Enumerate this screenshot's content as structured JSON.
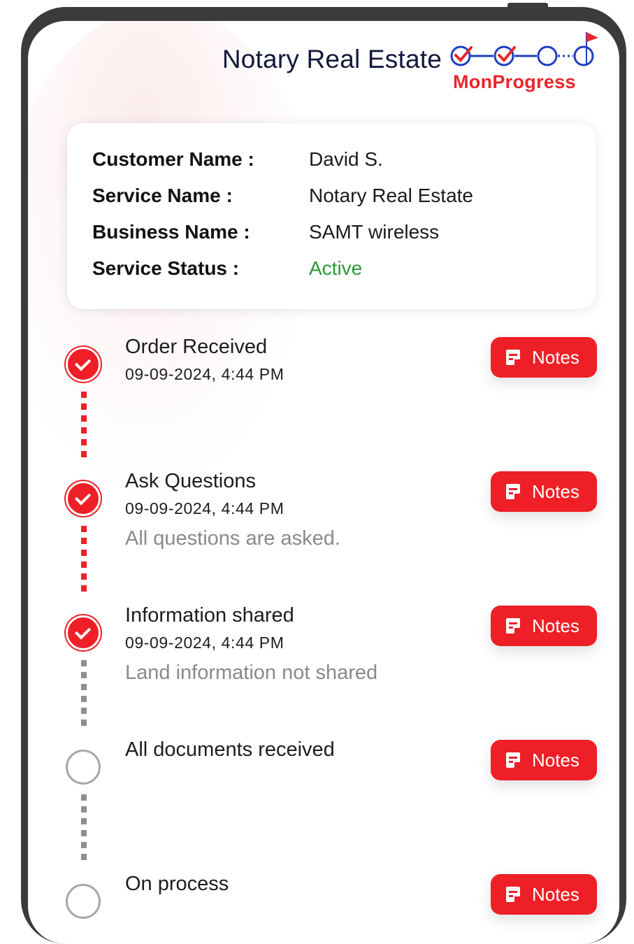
{
  "header": {
    "title": "Notary Real Estate",
    "brand": "MonProgress"
  },
  "details": {
    "rows": [
      {
        "label": "Customer Name :",
        "value": "David S."
      },
      {
        "label": "Service Name :",
        "value": "Notary Real Estate"
      },
      {
        "label": "Business Name :",
        "value": "SAMT wireless"
      },
      {
        "label": "Service Status :",
        "value": "Active"
      }
    ]
  },
  "steps": [
    {
      "title": "Order Received",
      "date": "09-09-2024, 4:44 PM",
      "note": "",
      "completed": true,
      "notes_label": "Notes"
    },
    {
      "title": "Ask Questions",
      "date": "09-09-2024, 4:44 PM",
      "note": "All questions are asked.",
      "completed": true,
      "notes_label": "Notes"
    },
    {
      "title": "Information shared",
      "date": "09-09-2024, 4:44 PM",
      "note": "Land information not shared",
      "completed": true,
      "notes_label": "Notes"
    },
    {
      "title": "All documents received",
      "date": "",
      "note": "",
      "completed": false,
      "notes_label": "Notes"
    },
    {
      "title": "On process",
      "date": "",
      "note": "",
      "completed": false,
      "notes_label": "Notes"
    }
  ],
  "colors": {
    "accent": "#ee1f26",
    "status_active": "#2a9a37",
    "connector_done": "#ee1f26",
    "connector_pending": "#8e8e95"
  }
}
